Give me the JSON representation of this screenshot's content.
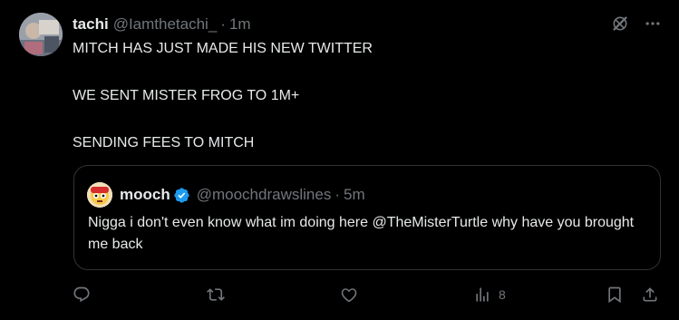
{
  "tweet": {
    "display_name": "tachi",
    "handle": "@Iamthetachi_",
    "time": "1m",
    "lines": [
      "MITCH HAS JUST MADE HIS NEW TWITTER",
      "WE SENT MISTER FROG TO 1M+",
      "SENDING FEES TO MITCH"
    ]
  },
  "quote": {
    "display_name": "mooch",
    "handle": "@moochdrawslines",
    "time": "5m",
    "text": "Nigga i don't even know what im doing here @TheMisterTurtle why have you brought me back",
    "verified_color": "#1d9bf0"
  },
  "actions": {
    "views_count": "8"
  },
  "colors": {
    "background": "#000000",
    "text": "#e7e9ea",
    "muted": "#71767b",
    "border": "#2f3336"
  },
  "icons": {
    "top": [
      "grok-icon",
      "more-icon"
    ],
    "bottom": [
      "reply-icon",
      "retweet-icon",
      "like-icon",
      "views-icon",
      "bookmark-icon",
      "share-icon"
    ]
  }
}
